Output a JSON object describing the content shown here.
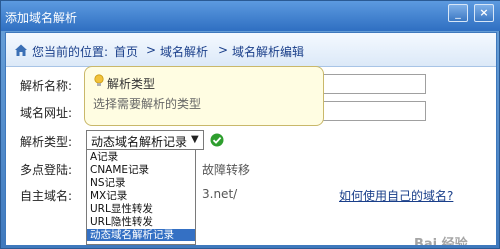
{
  "window": {
    "title": "添加域名解析"
  },
  "breadcrumb": {
    "prefix": "您当前的位置:",
    "items": [
      "首页",
      "域名解析",
      "域名解析编辑"
    ],
    "separator": ">"
  },
  "form": {
    "fields": [
      {
        "label": "解析名称:"
      },
      {
        "label": "域名网址:"
      },
      {
        "label": "解析类型:"
      },
      {
        "label": "多点登陆:"
      },
      {
        "label": "自主域名:"
      }
    ],
    "record_type": {
      "selected": "动态域名解析记录",
      "options": [
        "A记录",
        "CNAME记录",
        "NS记录",
        "MX记录",
        "URL显性转发",
        "URL隐性转发",
        "动态域名解析记录"
      ]
    },
    "multipoint_text": "故障转移",
    "domain_partial": "3.net/",
    "help_link": "如何使用自己的域名?"
  },
  "tooltip": {
    "title": "解析类型",
    "body": "选择需要解析的类型"
  },
  "watermark": "Bai 经验",
  "colors": {
    "accent": "#3470c4",
    "title_bar": "#2f6fc2",
    "tooltip_bg": "#fffde2",
    "ok": "#2e9e2e"
  }
}
